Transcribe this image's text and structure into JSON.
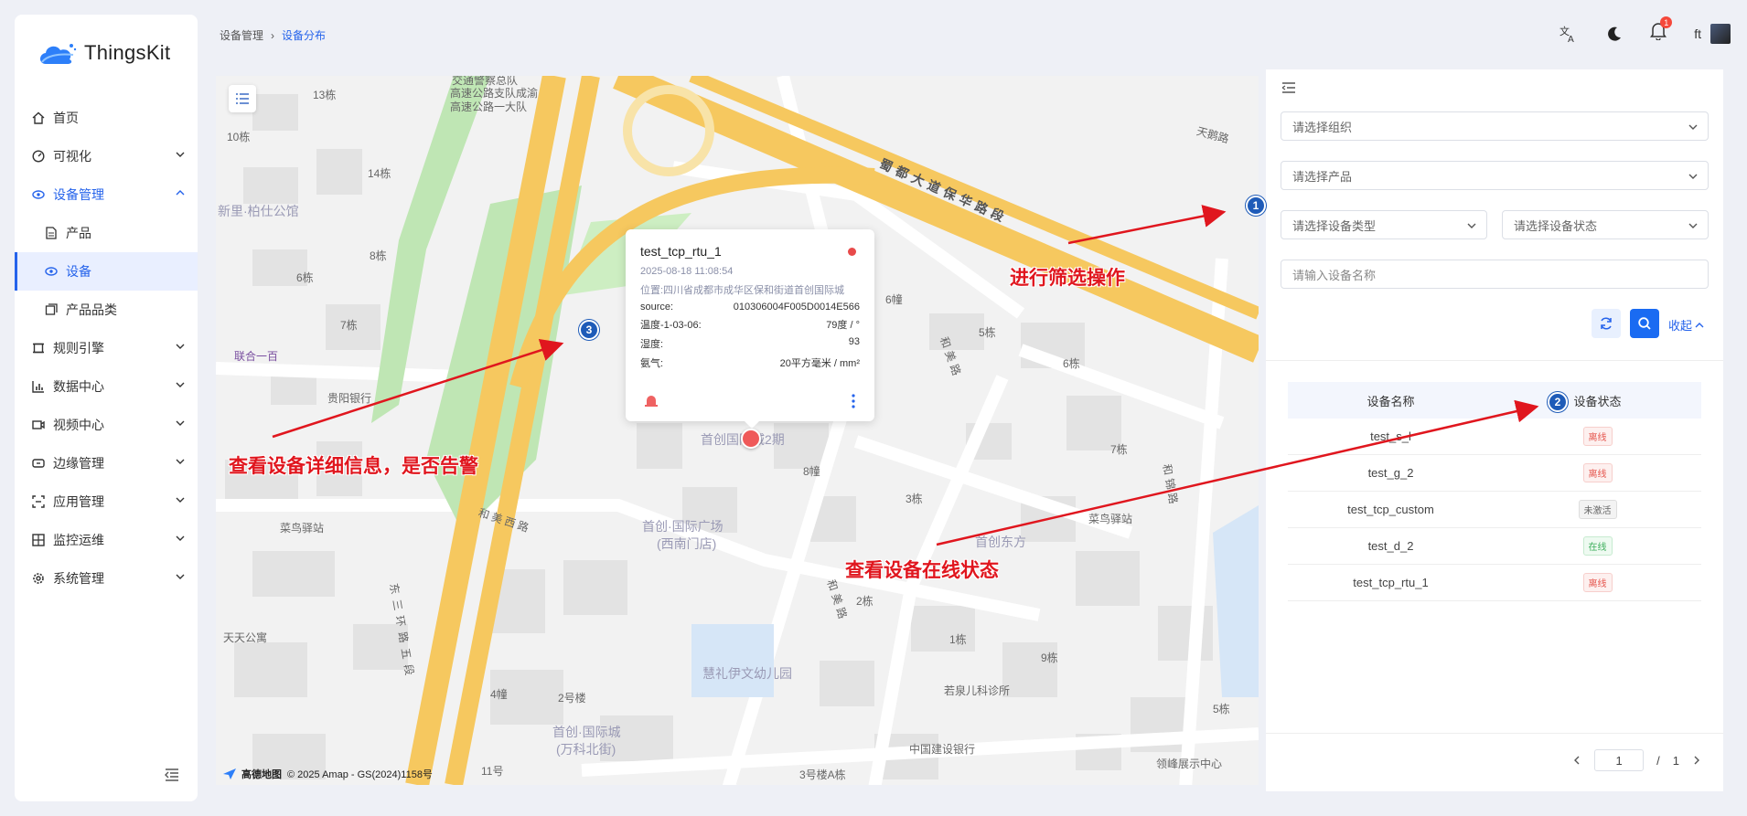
{
  "brand": {
    "name": "ThingsKit"
  },
  "sidebar": {
    "items": [
      {
        "label": "首页"
      },
      {
        "label": "可视化"
      },
      {
        "label": "设备管理"
      },
      {
        "label": "产品"
      },
      {
        "label": "设备"
      },
      {
        "label": "产品品类"
      },
      {
        "label": "规则引擎"
      },
      {
        "label": "数据中心"
      },
      {
        "label": "视频中心"
      },
      {
        "label": "边缘管理"
      },
      {
        "label": "应用管理"
      },
      {
        "label": "监控运维"
      },
      {
        "label": "系统管理"
      }
    ]
  },
  "breadcrumb": {
    "parent": "设备管理",
    "current": "设备分布"
  },
  "header": {
    "user": "ft",
    "notification_count": "1"
  },
  "map": {
    "popup": {
      "title": "test_tcp_rtu_1",
      "time": "2025-08-18 11:08:54",
      "location": "位置:四川省成都市成华区保和街道首创国际城",
      "rows": [
        {
          "k": "source:",
          "v": "010306004F005D0014E566"
        },
        {
          "k": "温度-1-03-06:",
          "v": "79度 / °"
        },
        {
          "k": "湿度:",
          "v": "93"
        },
        {
          "k": "氨气:",
          "v": "20平方毫米 / mm²"
        }
      ]
    },
    "labels": {
      "l1": "13栋",
      "l2": "10栋",
      "l3": "14栋",
      "l4": "新里·柏仕公馆",
      "l5": "6栋",
      "l6": "8栋",
      "l7": "7栋",
      "l8": "联合一百",
      "l9": "贵阳银行",
      "l10": "菜鸟驿站",
      "l11": "天天公寓",
      "l12": "4幢",
      "l13": "2号楼",
      "l14": "11号",
      "l15": "首创·国际城",
      "l16": "(万科北街)",
      "l17": "首创·国际广场",
      "l18": "(西南门店)",
      "l19": "慧礼伊文幼儿园",
      "l20": "若泉儿科诊所",
      "l21": "中国建设银行",
      "l22": "3号楼A栋",
      "l23": "领峰展示中心",
      "l24": "1栋",
      "l25": "9栋",
      "l26": "5栋",
      "l27": "2栋",
      "l28": "3栋",
      "l29": "8幢",
      "l30": "6幢",
      "l31": "5栋",
      "l32": "6栋",
      "l33": "7栋",
      "l34": "菜鸟驿站",
      "l35": "首创东方",
      "l36": "首创国际城2期",
      "l37": "交通警察总队",
      "l38": "高速公路支队成渝",
      "l39": "高速公路一大队",
      "l40": "天鹅路"
    },
    "roads": {
      "r1": "蜀都大道保华路段",
      "r2": "和美西路",
      "r3": "和美路",
      "r4": "东三环路五段",
      "r5": "和美路",
      "r6": "和锦路"
    },
    "copyright_logo": "高德地图",
    "copyright": "© 2025 Amap - GS(2024)1158号"
  },
  "annotations": {
    "a1": "进行筛选操作",
    "a2": "查看设备在线状态",
    "a3": "查看设备详细信息，是否告警",
    "n1": "1",
    "n2": "2",
    "n3": "3"
  },
  "filters": {
    "org_placeholder": "请选择组织",
    "product_placeholder": "请选择产品",
    "type_placeholder": "请选择设备类型",
    "status_placeholder": "请选择设备状态",
    "name_placeholder": "请输入设备名称",
    "collapse_label": "收起"
  },
  "table": {
    "headers": [
      "设备名称",
      "设备状态"
    ],
    "rows": [
      {
        "name": "test_s_l",
        "status": "离线"
      },
      {
        "name": "test_g_2",
        "status": "离线"
      },
      {
        "name": "test_tcp_custom",
        "status": "未激活"
      },
      {
        "name": "test_d_2",
        "status": "在线"
      },
      {
        "name": "test_tcp_rtu_1",
        "status": "离线"
      }
    ]
  },
  "pager": {
    "current": "1",
    "sep": "/",
    "total": "1"
  },
  "colors": {
    "accent": "#2563eb",
    "alarm": "#e84a4a",
    "annotation": "#e0161e",
    "badge": "#1e5bb8"
  }
}
